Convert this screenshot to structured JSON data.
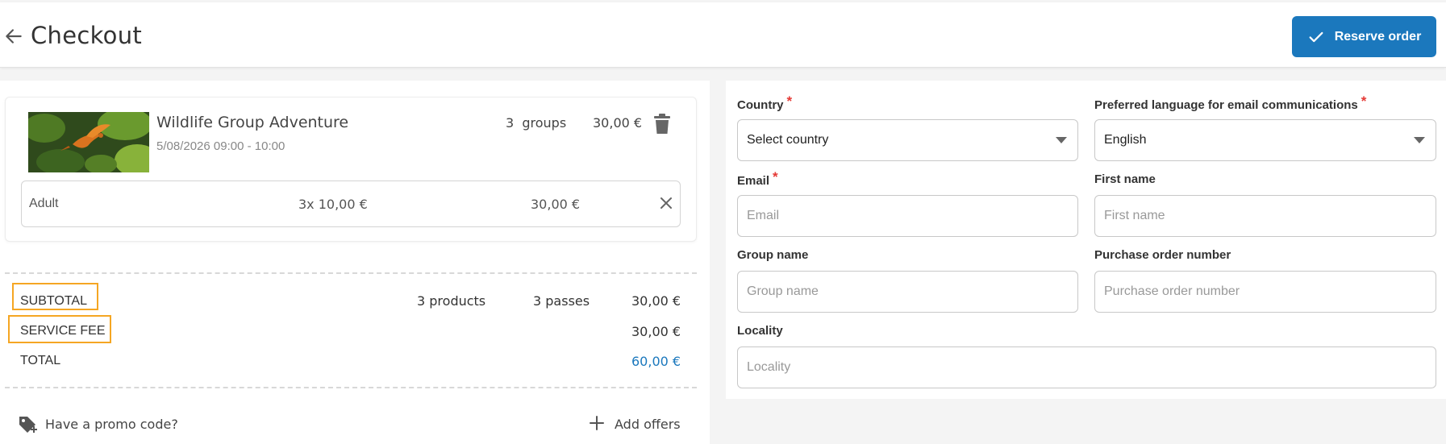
{
  "header": {
    "title": "Checkout",
    "reserve_label": "Reserve order",
    "accent": "#1b78bd"
  },
  "cart": {
    "product": {
      "name": "Wildlife Group Adventure",
      "datetime": "5/08/2026 09:00 - 10:00",
      "quantity": "3  groups",
      "price": "30,00 €",
      "image": "bird-in-flight-photo"
    },
    "ticket": {
      "type": "Adult",
      "unit": "3x 10,00 €",
      "total": "30,00 €"
    }
  },
  "summary": {
    "subtotal_label": "SUBTOTAL",
    "subtotal_products": "3 products",
    "subtotal_passes": "3 passes",
    "subtotal_value": "30,00 €",
    "fee_label": "SERVICE FEE",
    "fee_value": "30,00 €",
    "total_label": "TOTAL",
    "total_value": "60,00 €",
    "highlight_color": "#f5a623"
  },
  "actions": {
    "promo_label": "Have a promo code?",
    "offers_label": "Add offers"
  },
  "form": {
    "country": {
      "label": "Country",
      "value": "Select country",
      "required": "*"
    },
    "language": {
      "label": "Preferred language for email communications",
      "value": "English",
      "required": "*"
    },
    "email": {
      "label": "Email",
      "placeholder": "Email",
      "required": "*"
    },
    "first_name": {
      "label": "First name",
      "placeholder": "First name"
    },
    "group_name": {
      "label": "Group name",
      "placeholder": "Group name"
    },
    "po_number": {
      "label": "Purchase order number",
      "placeholder": "Purchase order number"
    },
    "locality": {
      "label": "Locality",
      "placeholder": "Locality"
    }
  }
}
